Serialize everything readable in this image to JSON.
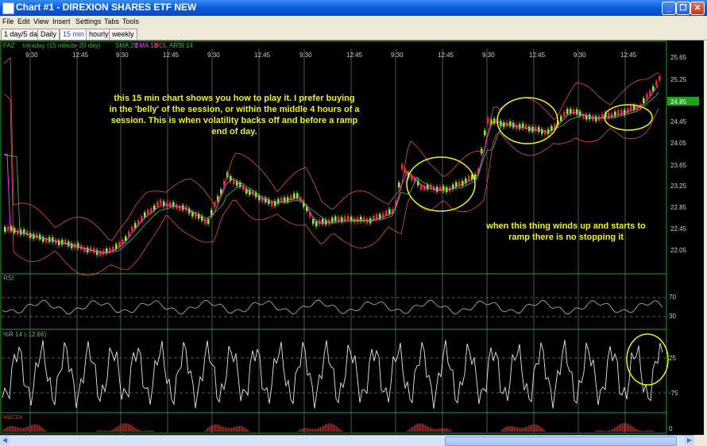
{
  "window": {
    "title": "Chart #1 - DIREXION SHARES ETF NEW",
    "minimize": "_",
    "maximize": "❐",
    "close": "✕"
  },
  "menu": [
    "File",
    "Edit",
    "View",
    "Insert",
    "Settings",
    "Tabs",
    "Tools"
  ],
  "tabs": [
    {
      "label": "1 day/5 day",
      "active": false
    },
    {
      "label": "Daily",
      "active": false
    },
    {
      "label": "15 min",
      "active": true
    },
    {
      "label": "hourly",
      "active": false
    },
    {
      "label": "weekly",
      "active": false
    }
  ],
  "chart_header": {
    "symbol": "FAZ",
    "interval": "Intraday (15 minute-20 day)",
    "indicators": [
      {
        "label": "SMA 20",
        "color": "#39B54A"
      },
      {
        "label": "EMA 10",
        "color": "#FF44FF"
      },
      {
        "label": "BOL",
        "color": "#E05050"
      },
      {
        "label": "ARSI 14",
        "color": "#39B54A"
      }
    ]
  },
  "time_labels": [
    "9:30",
    "12:45",
    "9:30",
    "12:45",
    "9:30",
    "12:45",
    "9:30",
    "12:45",
    "9:30",
    "12:45",
    "9:30",
    "12:45",
    "9:30",
    "12:45"
  ],
  "price_axis": [
    "25.65",
    "25.25",
    "24.85",
    "24.45",
    "24.05",
    "23.65",
    "23.25",
    "22.85",
    "22.45",
    "22.05"
  ],
  "last_price": "24.85",
  "panels": {
    "rsi": {
      "label": "RSI",
      "axis": [
        "70",
        "30"
      ]
    },
    "williams": {
      "label": "%R 14 (-12.66)",
      "axis": [
        "25",
        "-75"
      ]
    },
    "macd": {
      "label": "MACDh",
      "axis": [
        "0"
      ]
    }
  },
  "annotations": {
    "note1": [
      "this 15 min chart shows you how to play it.  I prefer buying",
      "in the 'belly' of the session, or within the middle 4 hours of a",
      "session.  This is when volatility backs off and before a ramp",
      "end of day."
    ],
    "note2": [
      "when this thing winds up and starts to",
      "ramp there is no stopping it"
    ]
  },
  "colors": {
    "up": "#7FFF00",
    "down": "#FF2020",
    "sma": "#39B54A",
    "ema": "#FF44FF",
    "bollinger": "#E05050",
    "annotation": "#F2F219"
  }
}
